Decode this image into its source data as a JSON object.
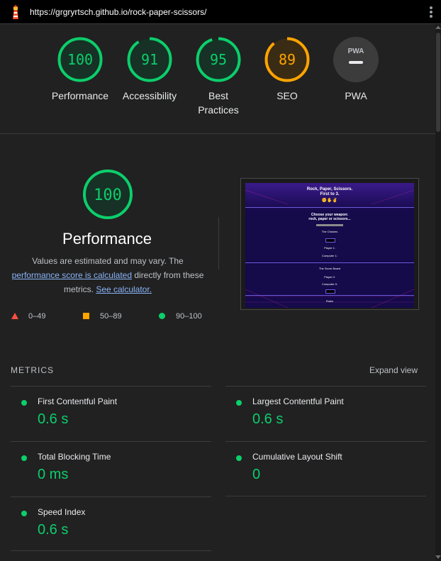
{
  "url": "https://grgryrtsch.github.io/rock-paper-scissors/",
  "colors": {
    "pass": "#0cce6b",
    "average": "#ffa400",
    "fail": "#ff4e42",
    "link": "#8ab4f8"
  },
  "summary": [
    {
      "label": "Performance",
      "score": "100",
      "value": 100,
      "rating": "pass"
    },
    {
      "label": "Accessibility",
      "score": "91",
      "value": 91,
      "rating": "pass"
    },
    {
      "label": "Best Practices",
      "score": "95",
      "value": 95,
      "rating": "pass"
    },
    {
      "label": "SEO",
      "score": "89",
      "value": 89,
      "rating": "average"
    },
    {
      "label": "PWA",
      "badge": "PWA",
      "rating": "na"
    }
  ],
  "performance": {
    "score": "100",
    "title": "Performance",
    "desc_pre": "Values are estimated and may vary. The ",
    "desc_link": "performance score is calculated",
    "desc_mid": " directly from these metrics. ",
    "calc_link": "See calculator."
  },
  "legend": {
    "fail": "0–49",
    "average": "50–89",
    "pass": "90–100"
  },
  "thumbnail": {
    "title_line1": "Rock, Paper, Scissors.",
    "title_line2": "First to 3.",
    "emoji": "✊✋✌",
    "choose_line1": "Choose your weapon:",
    "choose_line2": "rock, paper or scissors...",
    "choices_label": "The Choices",
    "button_label": "Play!",
    "player_label": "Player 1:",
    "computer_label": "Computer 1:",
    "score_label": "The Score Board",
    "player_score": "Player 0:",
    "computer_score": "Computer 0:",
    "reset_label": "Reset",
    "rules_label": "Rules"
  },
  "metrics": {
    "heading": "METRICS",
    "expand": "Expand view",
    "items": [
      {
        "name": "First Contentful Paint",
        "value": "0.6 s"
      },
      {
        "name": "Largest Contentful Paint",
        "value": "0.6 s"
      },
      {
        "name": "Total Blocking Time",
        "value": "0 ms"
      },
      {
        "name": "Cumulative Layout Shift",
        "value": "0"
      },
      {
        "name": "Speed Index",
        "value": "0.6 s"
      }
    ]
  }
}
